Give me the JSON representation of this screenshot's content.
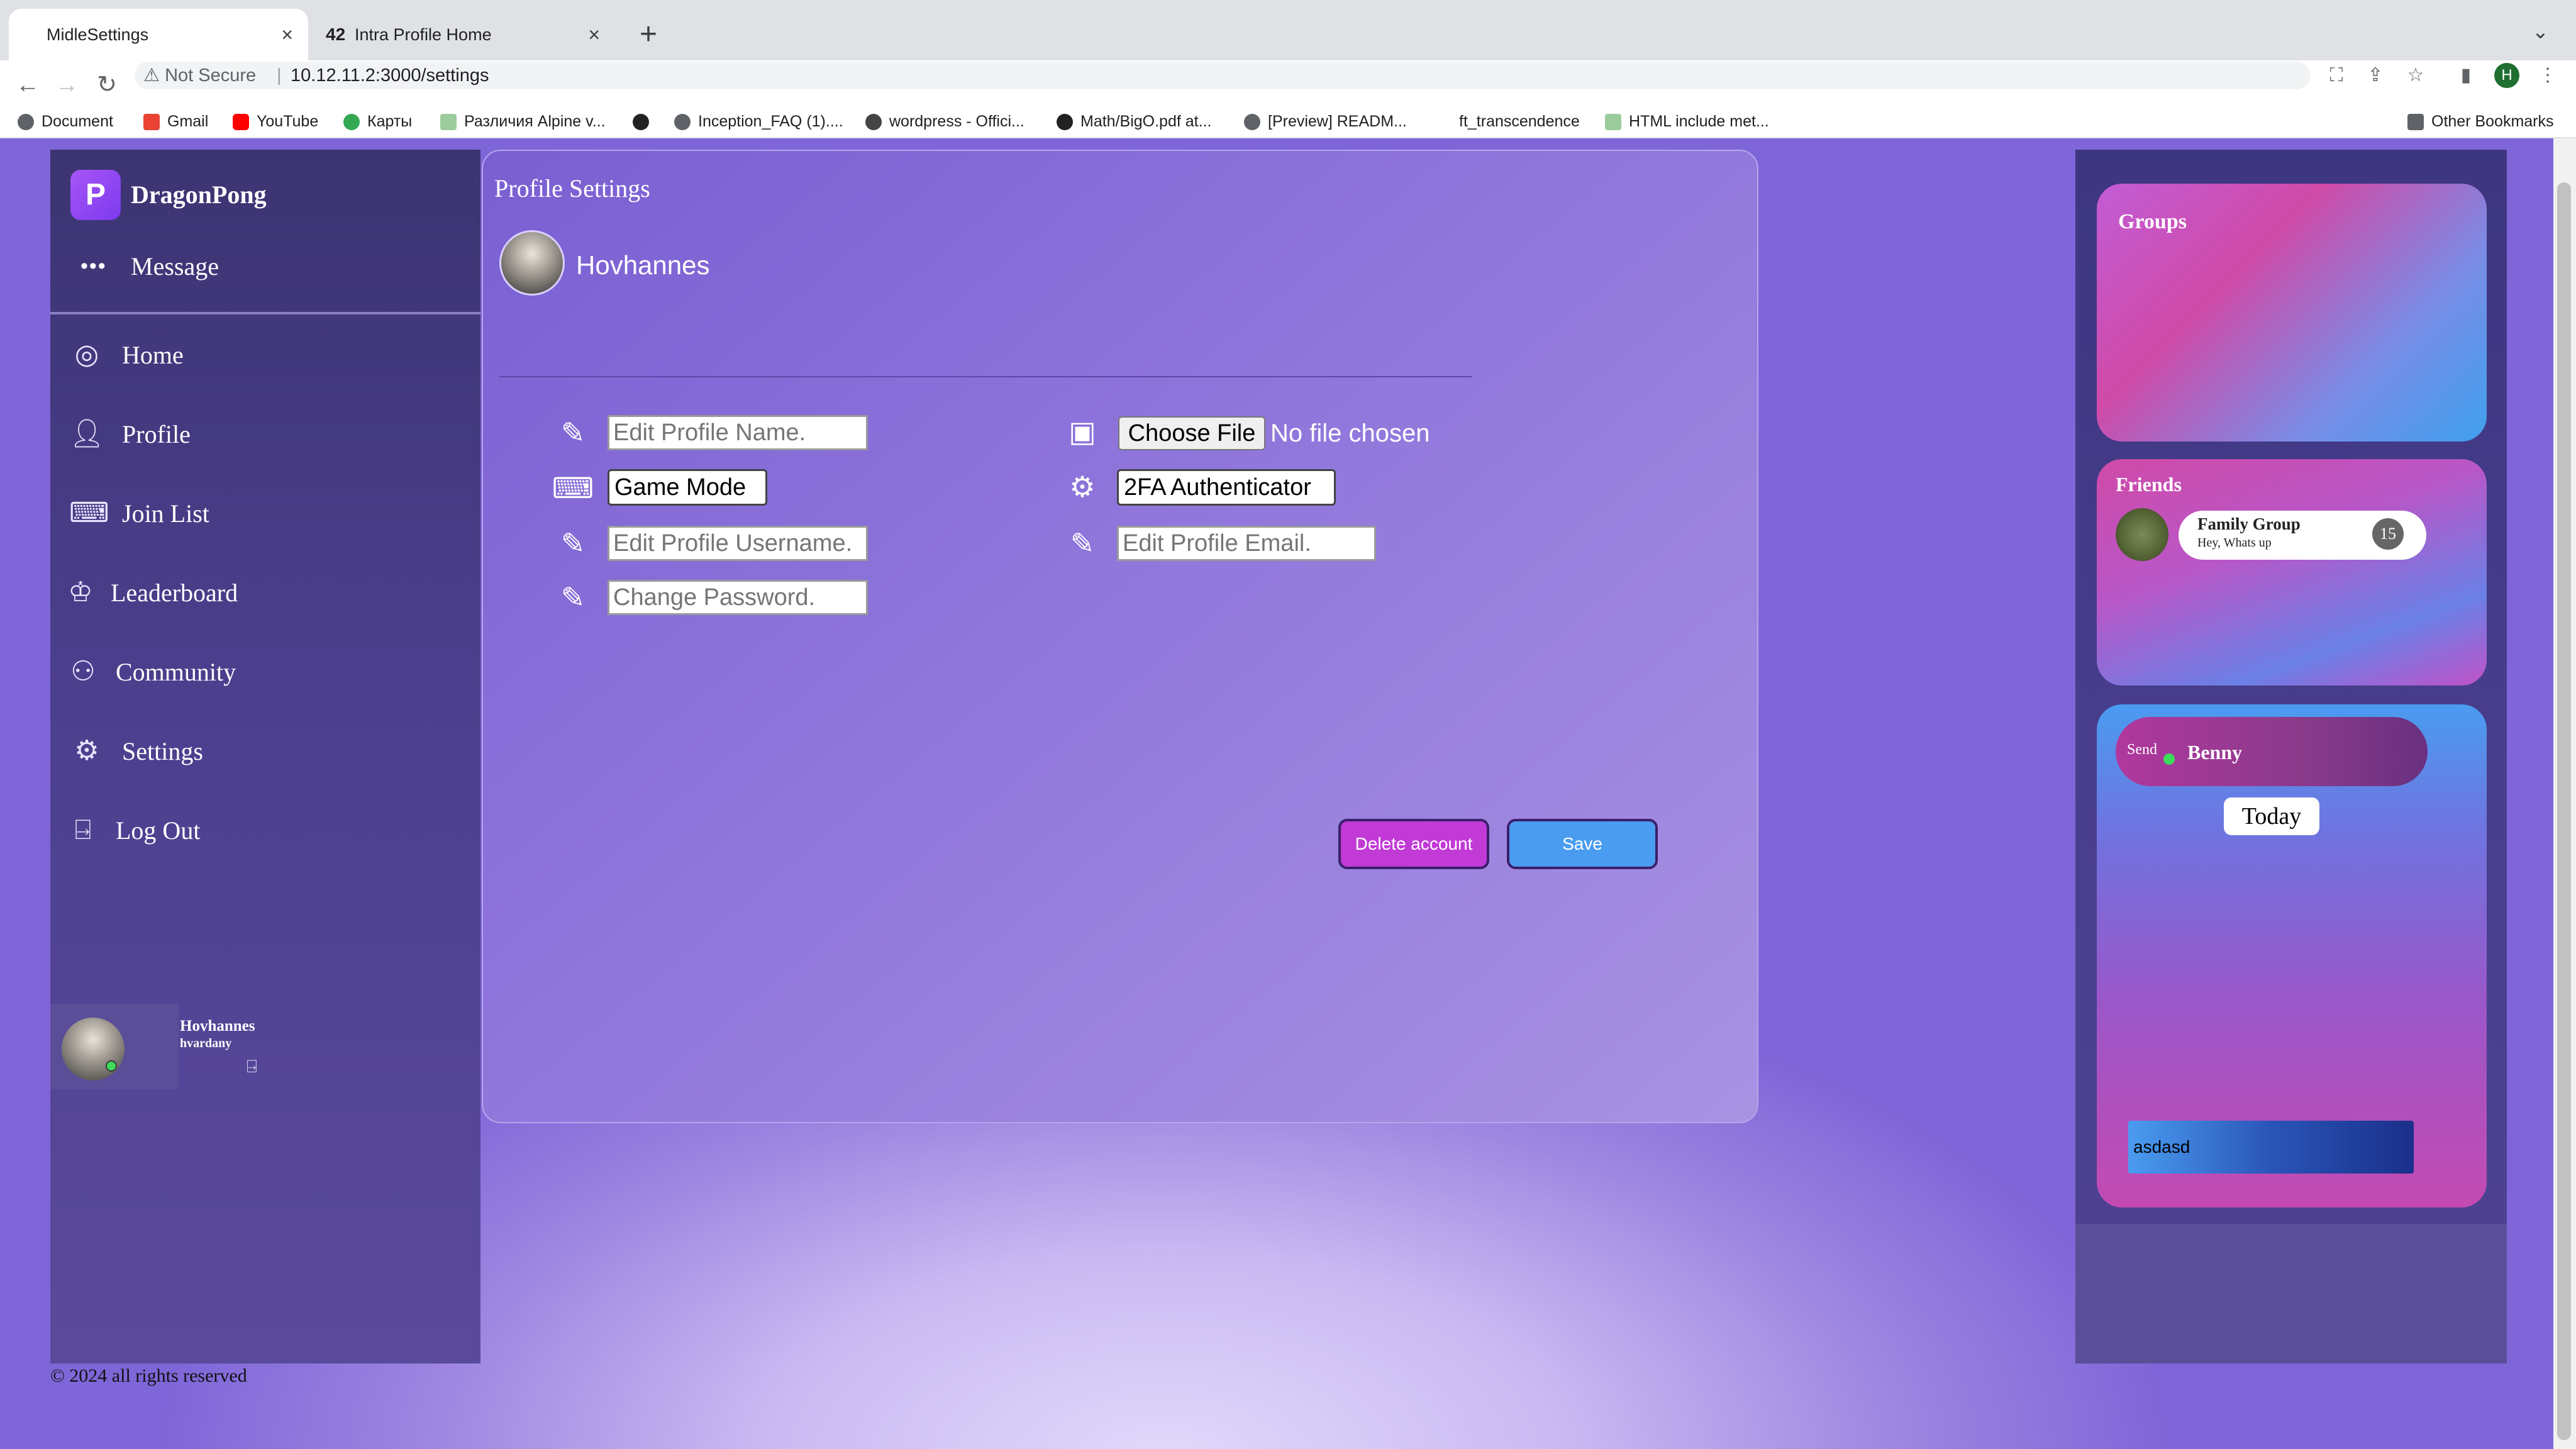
{
  "browser": {
    "tabs": [
      {
        "title": "MidleSettings",
        "active": true
      },
      {
        "title": "Intra Profile Home",
        "active": false
      }
    ],
    "new_tab_label": "+",
    "security_label": "Not Secure",
    "url": "10.12.11.2:3000/settings",
    "profile_initial": "H",
    "bookmarks": [
      "Document",
      "Gmail",
      "YouTube",
      "Карты",
      "Различия Alpine v...",
      "Inception_FAQ (1)....",
      "wordpress - Offici...",
      "Math/BigO.pdf at...",
      "[Preview] READM...",
      "ft_transcendence",
      "HTML include met..."
    ],
    "other_bookmarks": "Other Bookmarks"
  },
  "sidebar": {
    "app_name": "DragonPong",
    "message_label": "Message",
    "items": [
      {
        "label": "Home",
        "icon": "compass-icon"
      },
      {
        "label": "Profile",
        "icon": "user-icon"
      },
      {
        "label": "Join List",
        "icon": "gamepad-icon"
      },
      {
        "label": "Leaderboard",
        "icon": "trophy-icon"
      },
      {
        "label": "Community",
        "icon": "users-icon"
      },
      {
        "label": "Settings",
        "icon": "gear-icon"
      },
      {
        "label": "Log Out",
        "icon": "logout-icon"
      }
    ],
    "user": {
      "name": "Hovhannes",
      "login": "hvardany"
    }
  },
  "settings": {
    "title": "Profile Settings",
    "profile_name": "Hovhannes",
    "fields": {
      "profile_name_placeholder": "Edit Profile Name.",
      "game_mode": "Game Mode",
      "username_placeholder": "Edit Profile Username.",
      "password_placeholder": "Change Password.",
      "choose_file": "Choose File",
      "no_file": "No file chosen",
      "twofa": "2FA Authenticator",
      "email_placeholder": "Edit Profile Email."
    },
    "delete_label": "Delete account",
    "save_label": "Save"
  },
  "right": {
    "groups_title": "Groups",
    "friends_title": "Friends",
    "friend": {
      "name": "Family Group",
      "message": "Hey, Whats up",
      "badge": "15"
    },
    "chat": {
      "avatar_alt": "Send",
      "name": "Benny",
      "day": "Today",
      "input_value": "asdasd"
    }
  },
  "footer": {
    "copyright": "© 2024 all rights reserved"
  },
  "colors": {
    "accent_pink": "#c13ad6",
    "accent_blue": "#4a9cf0",
    "online": "#3ddc5a"
  }
}
